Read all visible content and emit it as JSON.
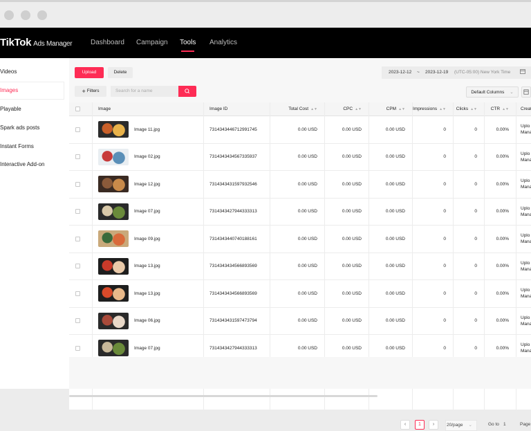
{
  "app": {
    "brand": "TikTok",
    "brand_suffix": "Ads Manager",
    "nav": [
      {
        "label": "Dashboard"
      },
      {
        "label": "Campaign"
      },
      {
        "label": "Tools",
        "active": true
      },
      {
        "label": "Analytics"
      }
    ]
  },
  "sidebar": {
    "items": [
      {
        "label": "Videos"
      },
      {
        "label": "Images",
        "active": true
      },
      {
        "label": "Playable"
      },
      {
        "label": "Spark ads posts"
      },
      {
        "label": "Instant Forms"
      },
      {
        "label": "Interactive Add-on"
      }
    ]
  },
  "toolbar": {
    "upload_label": "Upload",
    "delete_label": "Delete",
    "date_start": "2023-12-12",
    "date_sep": "~",
    "date_end": "2023-12-19",
    "timezone": "(UTC-05:00) New York Time",
    "filters_label": "Filters",
    "search_placeholder": "Search for a name",
    "columns_label": "Default Columns"
  },
  "table": {
    "columns": {
      "image": "Image",
      "image_id": "Image ID",
      "total_cost": "Total Cost",
      "cpc": "CPC",
      "cpm": "CPM",
      "impressions": "Impressions",
      "clicks": "Clicks",
      "ctr": "CTR",
      "created": "Creat"
    },
    "rows": [
      {
        "name": "Image 11.jpg",
        "id": "7314343446712991745",
        "total_cost": "0.00 USD",
        "cpc": "0.00 USD",
        "cpm": "0.00 USD",
        "impressions": "0",
        "clicks": "0",
        "ctr": "0.00%",
        "created_1": "Uplo",
        "created_2": "Mana"
      },
      {
        "name": "Image 02.jpg",
        "id": "7314343434567335937",
        "total_cost": "0.00 USD",
        "cpc": "0.00 USD",
        "cpm": "0.00 USD",
        "impressions": "0",
        "clicks": "0",
        "ctr": "0.00%",
        "created_1": "Uplo",
        "created_2": "Mana"
      },
      {
        "name": "Image 12.jpg",
        "id": "7314343431597932546",
        "total_cost": "0.00 USD",
        "cpc": "0.00 USD",
        "cpm": "0.00 USD",
        "impressions": "0",
        "clicks": "0",
        "ctr": "0.00%",
        "created_1": "Uplo",
        "created_2": "Mana"
      },
      {
        "name": "Image 07.jpg",
        "id": "7314343427944333313",
        "total_cost": "0.00 USD",
        "cpc": "0.00 USD",
        "cpm": "0.00 USD",
        "impressions": "0",
        "clicks": "0",
        "ctr": "0.00%",
        "created_1": "Uplo",
        "created_2": "Mana"
      },
      {
        "name": "Image 09.jpg",
        "id": "7314343440740188161",
        "total_cost": "0.00 USD",
        "cpc": "0.00 USD",
        "cpm": "0.00 USD",
        "impressions": "0",
        "clicks": "0",
        "ctr": "0.00%",
        "created_1": "Uplo",
        "created_2": "Mana"
      },
      {
        "name": "Image 13.jpg",
        "id": "7314343434566893569",
        "total_cost": "0.00 USD",
        "cpc": "0.00 USD",
        "cpm": "0.00 USD",
        "impressions": "0",
        "clicks": "0",
        "ctr": "0.00%",
        "created_1": "Uplo",
        "created_2": "Mana"
      },
      {
        "name": "Image 13.jpg",
        "id": "7314343434566893569",
        "total_cost": "0.00 USD",
        "cpc": "0.00 USD",
        "cpm": "0.00 USD",
        "impressions": "0",
        "clicks": "0",
        "ctr": "0.00%",
        "created_1": "Uplo",
        "created_2": "Mana"
      },
      {
        "name": "Image 06.jpg",
        "id": "7314343431597473794",
        "total_cost": "0.00 USD",
        "cpc": "0.00 USD",
        "cpm": "0.00 USD",
        "impressions": "0",
        "clicks": "0",
        "ctr": "0.00%",
        "created_1": "Uplo",
        "created_2": "Mana"
      },
      {
        "name": "Image 07.jpg",
        "id": "7314343427944333313",
        "total_cost": "0.00 USD",
        "cpc": "0.00 USD",
        "cpm": "0.00 USD",
        "impressions": "0",
        "clicks": "0",
        "ctr": "0.00%",
        "created_1": "Uplo",
        "created_2": "Mana"
      }
    ]
  },
  "pagination": {
    "current_page": "1",
    "page_size": "20/page",
    "goto_label": "Go to",
    "goto_value": "1",
    "page_label": "Page"
  },
  "colors": {
    "accent": "#fe2c55",
    "nav_bg": "#000000"
  }
}
